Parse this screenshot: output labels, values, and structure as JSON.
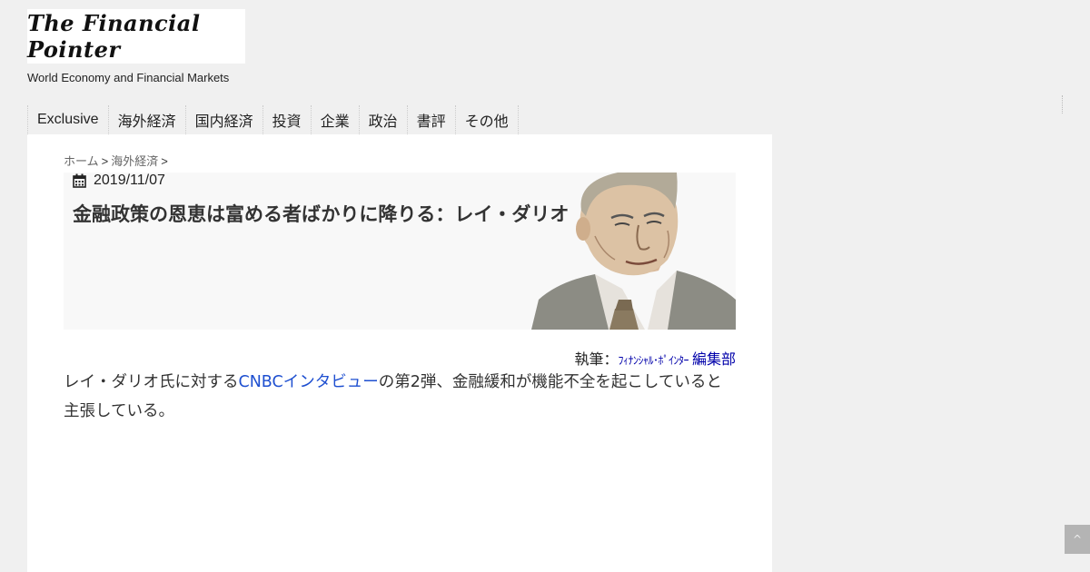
{
  "site": {
    "logo_text": "The Financial Pointer",
    "tagline": "World Economy and Financial Markets"
  },
  "nav": {
    "items": [
      {
        "label": "Exclusive"
      },
      {
        "label": "海外経済"
      },
      {
        "label": "国内経済"
      },
      {
        "label": "投資"
      },
      {
        "label": "企業"
      },
      {
        "label": "政治"
      },
      {
        "label": "書評"
      },
      {
        "label": "その他"
      }
    ]
  },
  "breadcrumb": {
    "home": "ホーム",
    "category": "海外経済",
    "separator": ">"
  },
  "article": {
    "date": "2019/11/07",
    "title": "金融政策の恩恵は富める者ばかりに降りる：レイ・ダリオ",
    "byline_prefix": "執筆：",
    "byline_author_small": "ﾌｨﾅﾝｼｬﾙ･ﾎﾟｲﾝﾀｰ",
    "byline_author_dept": "編集部",
    "body_before_link": "レイ・ダリオ氏に対する",
    "body_link": "CNBCインタビュー",
    "body_after_link": "の第2弾、金融緩和が機能不全を起こしていると主張している。"
  },
  "scroll_top": {
    "icon": "chevron-up-icon",
    "label": "^"
  }
}
